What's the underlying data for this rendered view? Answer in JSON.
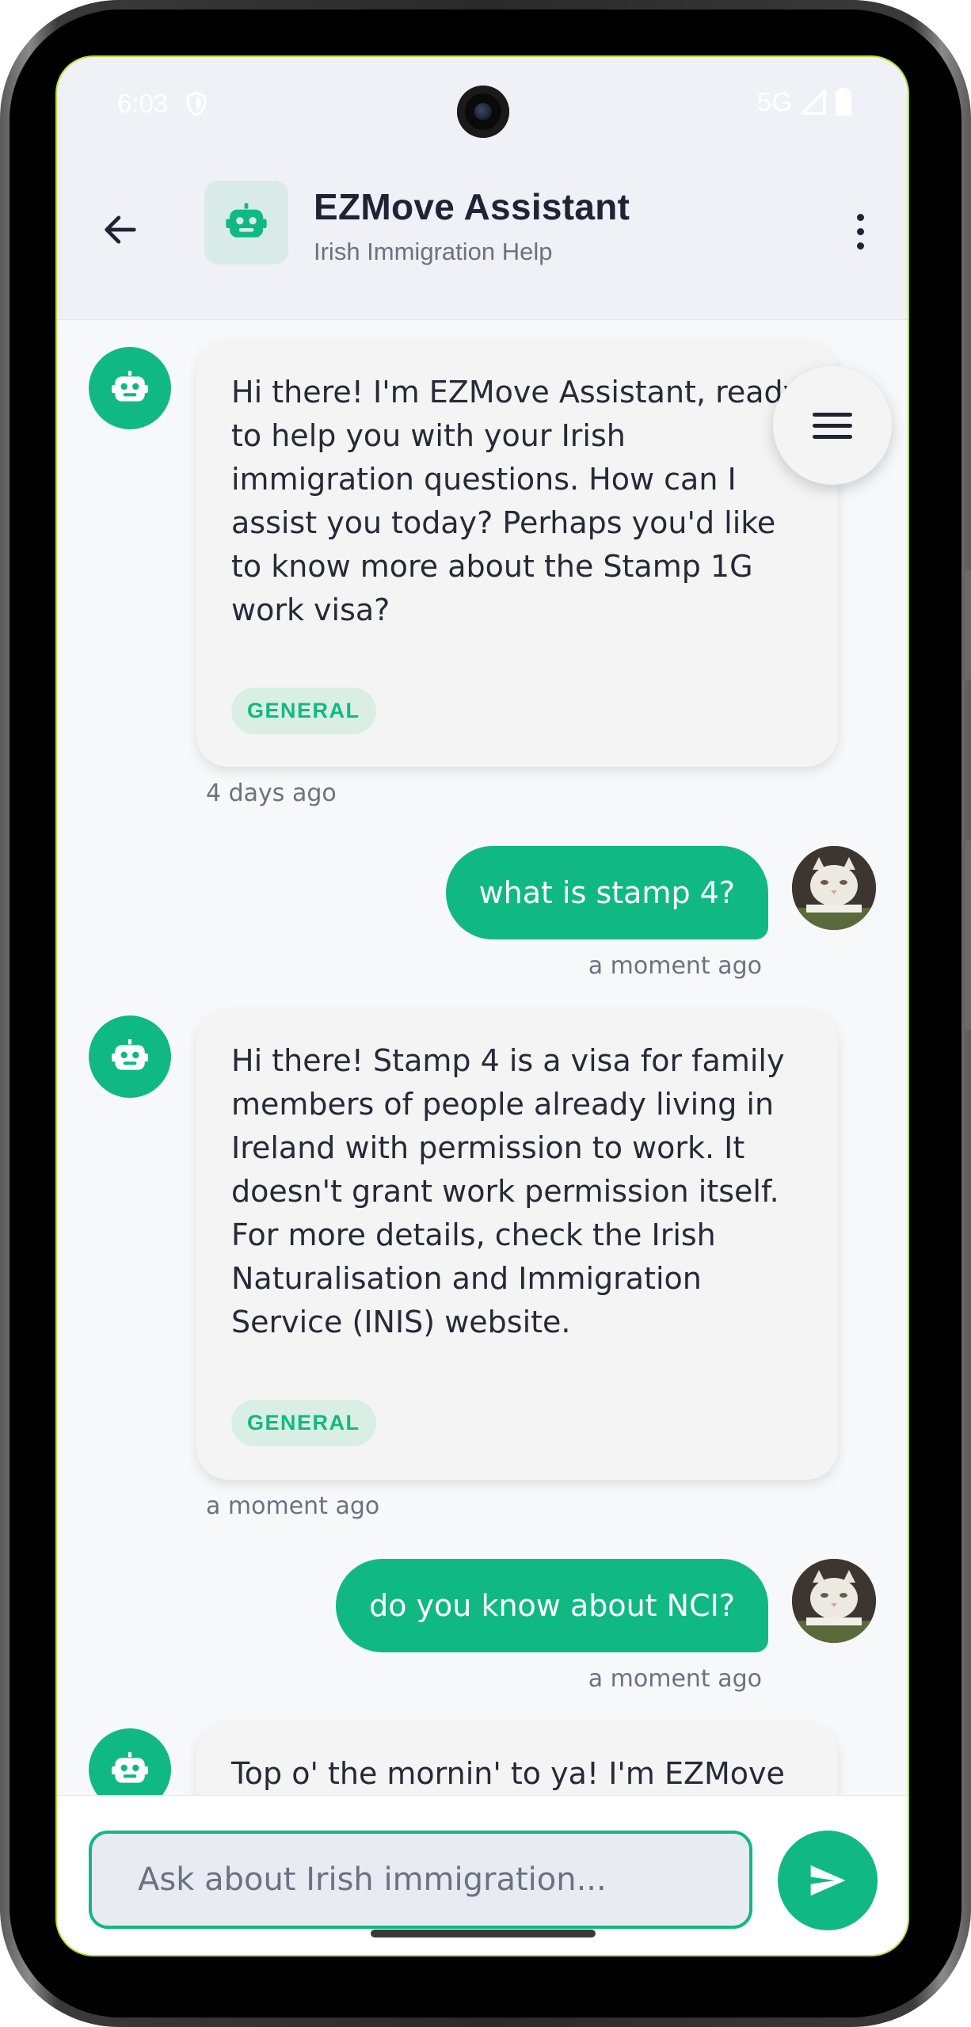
{
  "status_bar": {
    "time": "6:03",
    "network": "5G"
  },
  "header": {
    "back_icon": "arrow-left-icon",
    "title": "EZMove Assistant",
    "subtitle": "Irish Immigration Help",
    "more_icon": "more-vert-icon"
  },
  "messages": [
    {
      "sender": "bot",
      "text": "Hi there!  I'm EZMove Assistant, ready to help you with your Irish immigration questions.  How can I assist you today?  Perhaps you'd like to know more about the Stamp 1G work visa?",
      "tag": "GENERAL",
      "time": "4 days ago"
    },
    {
      "sender": "user",
      "text": "what is stamp 4?",
      "time": "a moment ago"
    },
    {
      "sender": "bot",
      "text": "Hi there!  Stamp 4 is a visa for family members of people already living in Ireland with permission to work.  It doesn't grant work permission itself.  For more details, check the Irish Naturalisation and Immigration Service (INIS) website.",
      "tag": "GENERAL",
      "time": "a moment ago"
    },
    {
      "sender": "user",
      "text": "do you know about NCI?",
      "time": "a moment ago"
    },
    {
      "sender": "bot",
      "text": "Top o' the mornin' to ya! I'm EZMove"
    }
  ],
  "composer": {
    "placeholder": "Ask about Irish immigration...",
    "send_icon": "send-icon"
  },
  "fab": {
    "icon": "menu-icon"
  },
  "colors": {
    "accent": "#10b981",
    "accent_soft": "#d9efe4",
    "bot_bubble": "#f4f4f5",
    "header_bg": "#eff1f6"
  }
}
